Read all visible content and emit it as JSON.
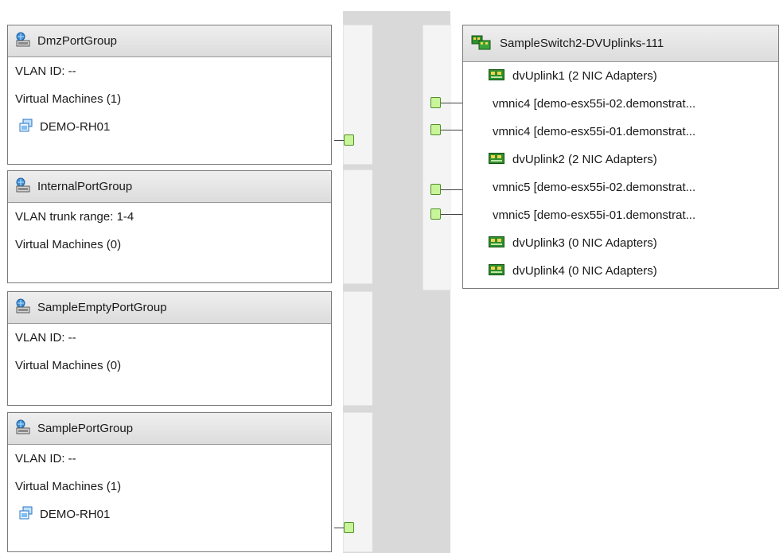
{
  "port_groups": [
    {
      "name": "DmzPortGroup",
      "vlan": "VLAN ID: --",
      "vms_label": "Virtual Machines (1)",
      "vms": [
        "DEMO-RH01"
      ]
    },
    {
      "name": "InternalPortGroup",
      "vlan": "VLAN trunk range: 1-4",
      "vms_label": "Virtual Machines (0)",
      "vms": []
    },
    {
      "name": "SampleEmptyPortGroup",
      "vlan": "VLAN ID: --",
      "vms_label": "Virtual Machines (0)",
      "vms": []
    },
    {
      "name": "SamplePortGroup",
      "vlan": "VLAN ID: --",
      "vms_label": "Virtual Machines (1)",
      "vms": [
        "DEMO-RH01"
      ]
    }
  ],
  "uplink_switch": {
    "title": "SampleSwitch2-DVUplinks-111",
    "rows": [
      {
        "kind": "uplink",
        "label": "dvUplink1 (2 NIC Adapters)"
      },
      {
        "kind": "nic",
        "label": "vmnic4 [demo-esx55i-02.demonstrat..."
      },
      {
        "kind": "nic",
        "label": "vmnic4 [demo-esx55i-01.demonstrat..."
      },
      {
        "kind": "uplink",
        "label": "dvUplink2 (2 NIC Adapters)"
      },
      {
        "kind": "nic",
        "label": "vmnic5 [demo-esx55i-02.demonstrat..."
      },
      {
        "kind": "nic",
        "label": "vmnic5 [demo-esx55i-01.demonstrat..."
      },
      {
        "kind": "uplink",
        "label": "dvUplink3 (0 NIC Adapters)"
      },
      {
        "kind": "uplink",
        "label": "dvUplink4 (0 NIC Adapters)"
      }
    ]
  },
  "colors": {
    "port_fill": "#c9f59a",
    "port_border": "#4f8f2a",
    "spine": "#d9d9d9",
    "header": "#e3e3e3"
  }
}
